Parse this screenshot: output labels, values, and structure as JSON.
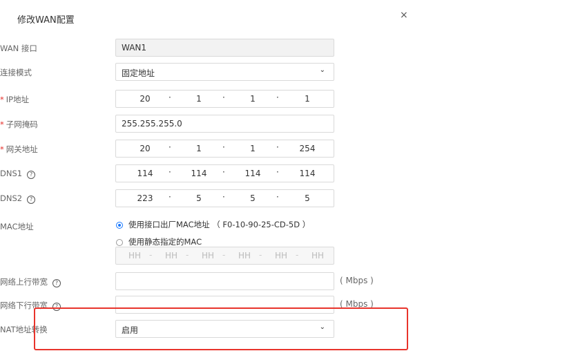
{
  "dialog": {
    "title": "修改WAN配置",
    "close": "×"
  },
  "wan_interface": {
    "label": "WAN 接口",
    "value": "WAN1"
  },
  "connection_mode": {
    "label": "连接模式",
    "value": "固定地址"
  },
  "ip_address": {
    "label": "IP地址",
    "required": "*",
    "octets": [
      "20",
      "1",
      "1",
      "1"
    ]
  },
  "subnet_mask": {
    "label": "子网掩码",
    "required": "*",
    "value": "255.255.255.0"
  },
  "gateway": {
    "label": "网关地址",
    "required": "*",
    "octets": [
      "20",
      "1",
      "1",
      "254"
    ]
  },
  "dns1": {
    "label": "DNS1",
    "octets": [
      "114",
      "114",
      "114",
      "114"
    ]
  },
  "dns2": {
    "label": "DNS2",
    "octets": [
      "223",
      "5",
      "5",
      "5"
    ]
  },
  "mac": {
    "label": "MAC地址",
    "option_factory": "使用接口出厂MAC地址 （ F0-10-90-25-CD-5D ）",
    "option_static": "使用静态指定的MAC",
    "placeholders": [
      "HH",
      "HH",
      "HH",
      "HH",
      "HH",
      "HH"
    ],
    "separator": "-"
  },
  "upload_bandwidth": {
    "label": "网络上行带宽",
    "value": "",
    "unit": "( Mbps )"
  },
  "download_bandwidth": {
    "label": "网络下行带宽",
    "value": "",
    "unit": "( Mbps )"
  },
  "nat": {
    "label": "NAT地址转换",
    "value": "启用"
  },
  "icons": {
    "help": "?",
    "chevron": "⌄",
    "dot": "·"
  },
  "colors": {
    "required": "#e5302b",
    "highlight": "#e8332b",
    "radio_selected": "#1677ff"
  }
}
